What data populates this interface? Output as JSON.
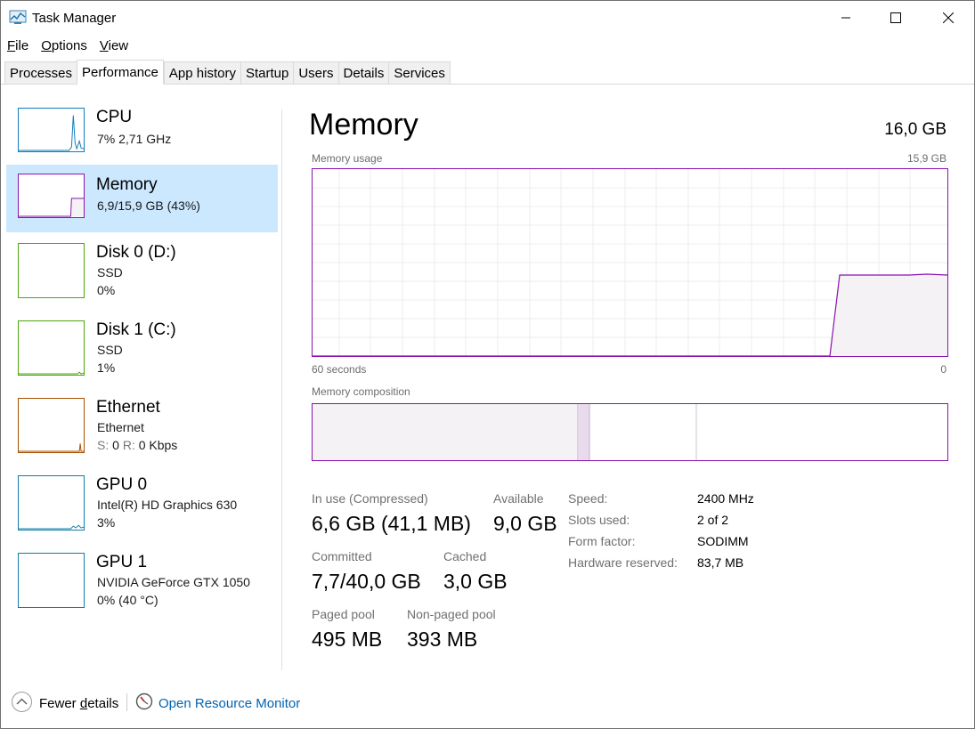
{
  "window": {
    "title": "Task Manager"
  },
  "menu": [
    {
      "key": "F",
      "rest": "ile"
    },
    {
      "key": "O",
      "rest": "ptions"
    },
    {
      "key": "V",
      "rest": "iew"
    }
  ],
  "tabs": [
    "Processes",
    "Performance",
    "App history",
    "Startup",
    "Users",
    "Details",
    "Services"
  ],
  "sidebar": {
    "cpu": {
      "title": "CPU",
      "line1": "7%  2,71 GHz",
      "color": "#117dbb"
    },
    "memory": {
      "title": "Memory",
      "line1": "6,9/15,9 GB (43%)",
      "color": "#8b12ae"
    },
    "disk0": {
      "title": "Disk 0 (D:)",
      "line1": "SSD",
      "line2": "0%",
      "color": "#4da60c"
    },
    "disk1": {
      "title": "Disk 1 (C:)",
      "line1": "SSD",
      "line2": "1%",
      "color": "#4da60c"
    },
    "ethernet": {
      "title": "Ethernet",
      "line1": "Ethernet",
      "s_label": "S:",
      "s_value": "0",
      "r_label": "R:",
      "r_value": "0 Kbps",
      "color": "#a74f01"
    },
    "gpu0": {
      "title": "GPU 0",
      "line1": "Intel(R) HD Graphics 630",
      "line2": "3%",
      "color": "#0f7ea8"
    },
    "gpu1": {
      "title": "GPU 1",
      "line1": "NVIDIA GeForce GTX 1050",
      "line2": "0%  (40 °C)",
      "color": "#0f7ea8"
    }
  },
  "main": {
    "title": "Memory",
    "total": "16,0 GB",
    "usage_label": "Memory usage",
    "usage_max": "15,9 GB",
    "axis_left": "60 seconds",
    "axis_right": "0",
    "composition_label": "Memory composition",
    "usage_fraction": 0.43,
    "stats": {
      "in_use_label": "In use (Compressed)",
      "in_use_value": "6,6 GB (41,1 MB)",
      "available_label": "Available",
      "available_value": "9,0 GB",
      "committed_label": "Committed",
      "committed_value": "7,7/40,0 GB",
      "cached_label": "Cached",
      "cached_value": "3,0 GB",
      "paged_label": "Paged pool",
      "paged_value": "495 MB",
      "nonpaged_label": "Non-paged pool",
      "nonpaged_value": "393 MB"
    },
    "details": {
      "speed_label": "Speed:",
      "speed_value": "2400 MHz",
      "slots_label": "Slots used:",
      "slots_value": "2 of 2",
      "form_label": "Form factor:",
      "form_value": "SODIMM",
      "reserved_label": "Hardware reserved:",
      "reserved_value": "83,7 MB"
    }
  },
  "footer": {
    "fewer_prefix": "Fewer ",
    "fewer_key": "d",
    "fewer_suffix": "etails",
    "resource_monitor": "Open Resource Monitor"
  },
  "colors": {
    "memory": "#8b12ae",
    "memory_fill": "#f4f2f4",
    "selected": "#cce8ff",
    "link": "#0063b1"
  }
}
